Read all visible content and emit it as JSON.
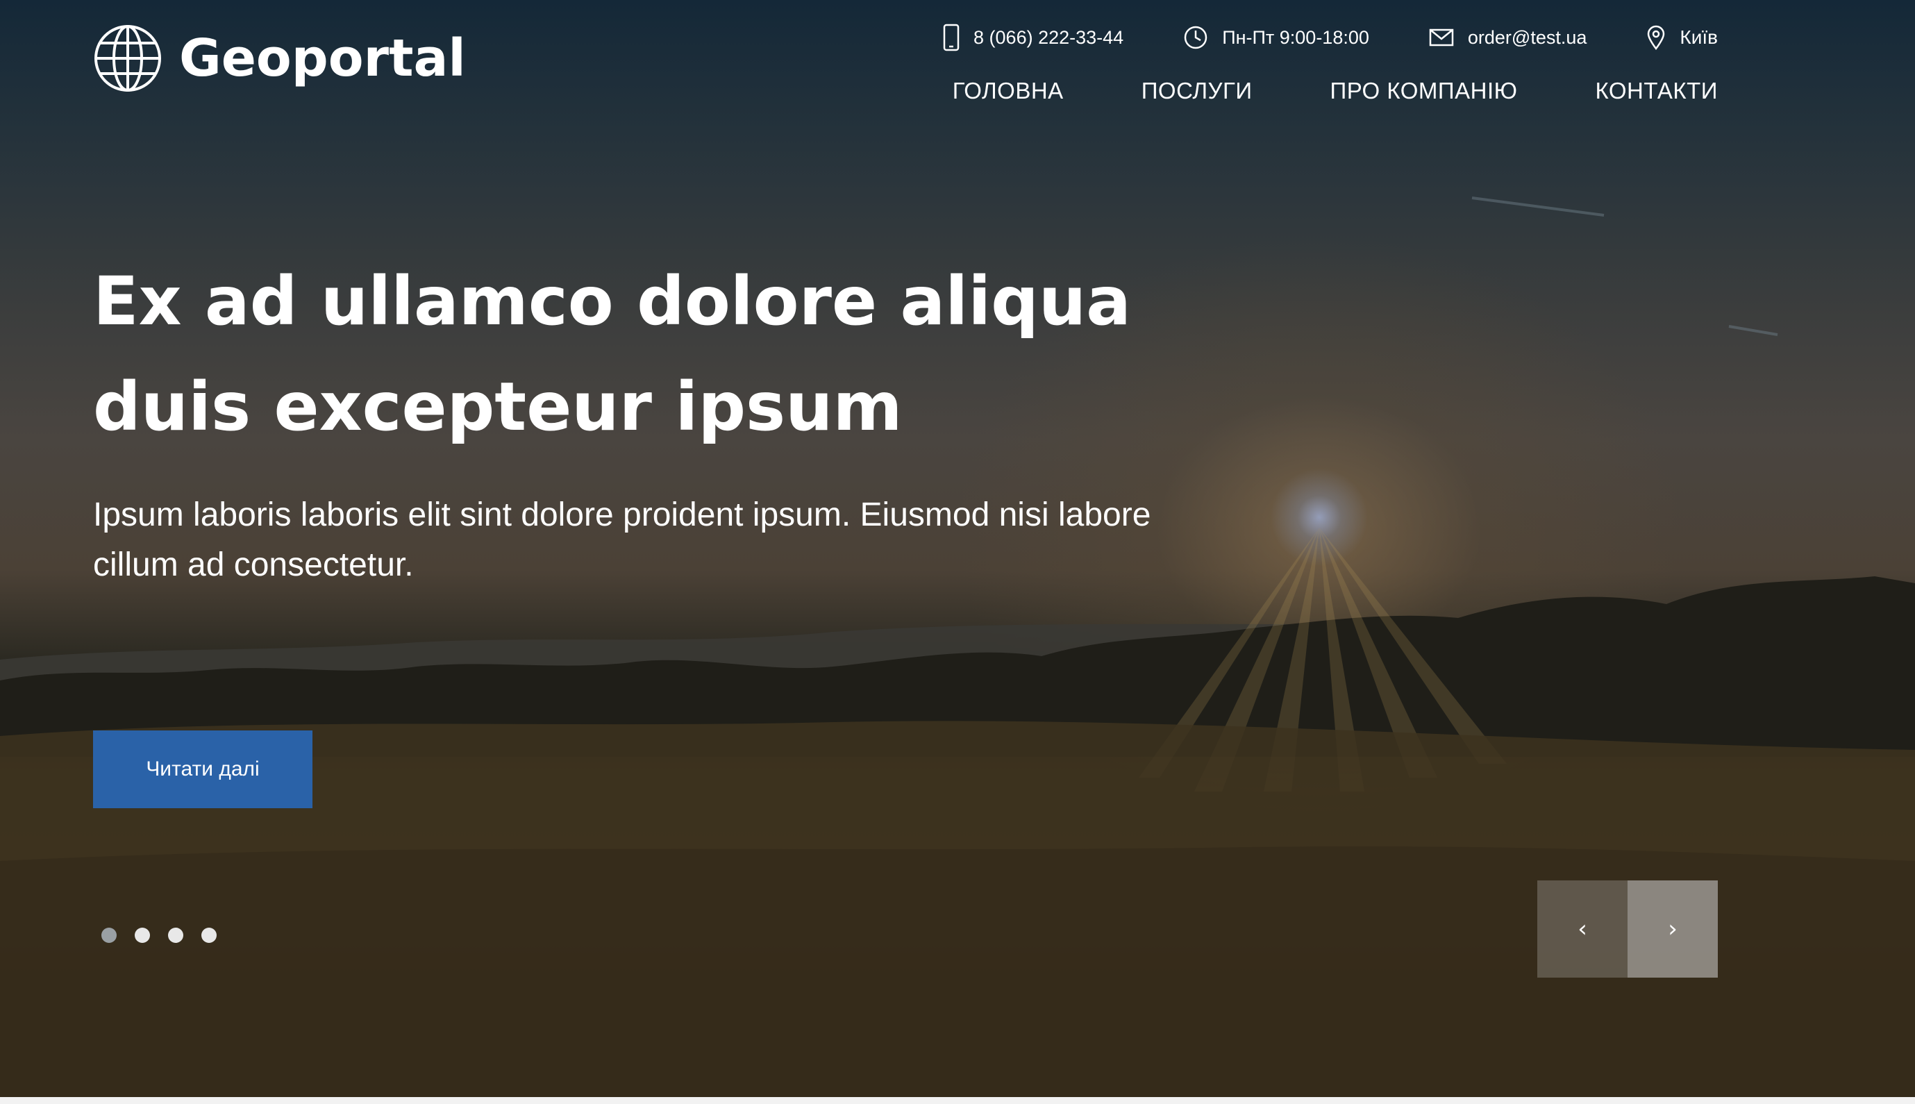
{
  "header": {
    "logo_text": "Geoportal",
    "logo_icon": "globe-icon",
    "contacts": {
      "phone": "8 (066) 222-33-44",
      "hours": "Пн-Пт 9:00-18:00",
      "email": "order@test.ua",
      "city": "Київ"
    },
    "nav": [
      "ГОЛОВНА",
      "ПОСЛУГИ",
      "ПРО КОМПАНІЮ",
      "КОНТАКТИ"
    ]
  },
  "hero": {
    "headline_line1": "Ex ad ullamco dolore aliqua",
    "headline_line2": "duis excepteur ipsum",
    "subtext": "Ipsum laboris laboris elit sint dolore proident ipsum. Eiusmod nisi labore cillum ad consectetur.",
    "cta_label": "Читати далі",
    "cta_color": "#2a62a8"
  },
  "slider": {
    "slide_count": 4,
    "active_slide": 1,
    "prev_glyph": "‹",
    "next_glyph": "›"
  }
}
